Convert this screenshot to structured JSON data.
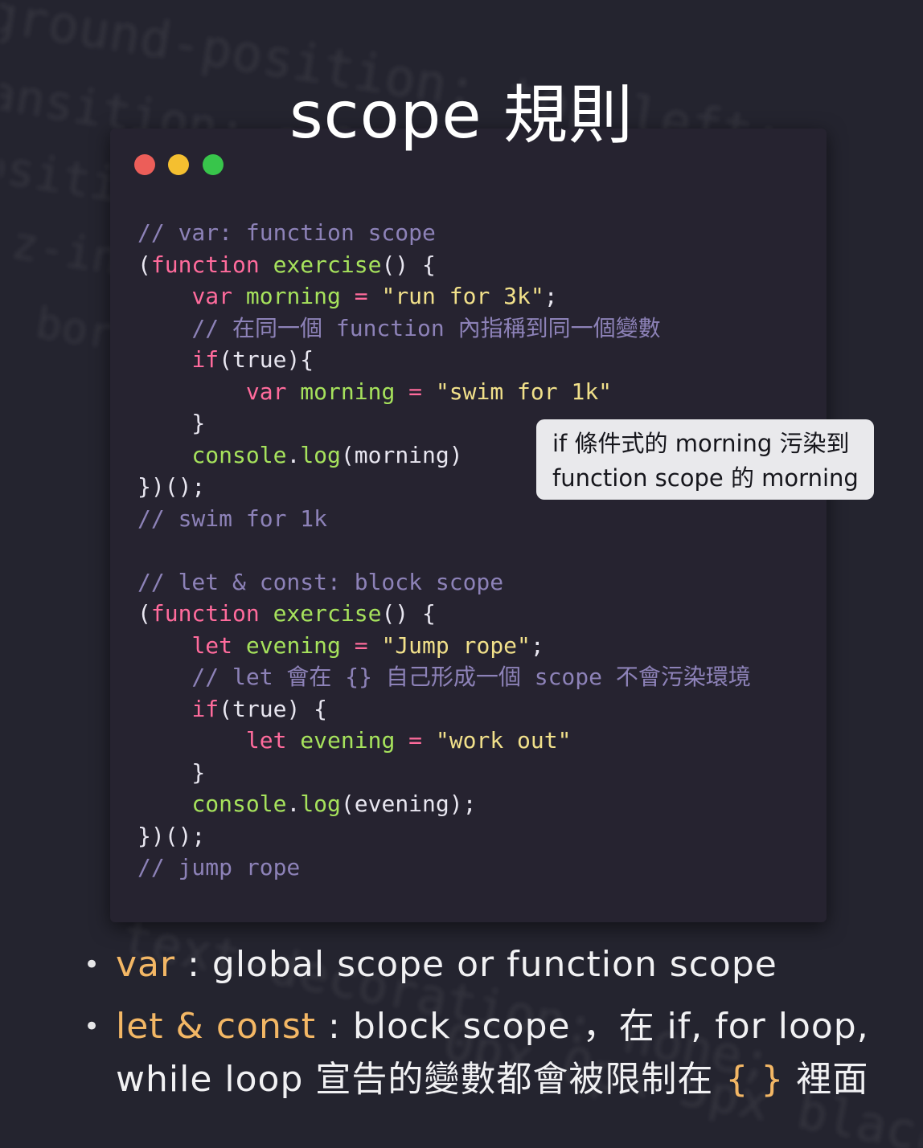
{
  "title": "scope 規則",
  "window_controls": {
    "close_color": "#ec5e59",
    "minimize_color": "#f4bf30",
    "maximize_color": "#38c54b"
  },
  "code_lines": [
    [
      {
        "t": "// var: function scope",
        "c": "comment"
      }
    ],
    [
      {
        "t": "(",
        "c": "plain"
      },
      {
        "t": "function",
        "c": "kw"
      },
      {
        "t": " ",
        "c": "plain"
      },
      {
        "t": "exercise",
        "c": "fn"
      },
      {
        "t": "() {",
        "c": "plain"
      }
    ],
    [
      {
        "t": "    ",
        "c": "plain"
      },
      {
        "t": "var",
        "c": "kw"
      },
      {
        "t": " ",
        "c": "plain"
      },
      {
        "t": "morning",
        "c": "fn"
      },
      {
        "t": " ",
        "c": "plain"
      },
      {
        "t": "=",
        "c": "kw"
      },
      {
        "t": " ",
        "c": "plain"
      },
      {
        "t": "\"run for 3k\"",
        "c": "str"
      },
      {
        "t": ";",
        "c": "plain"
      }
    ],
    [
      {
        "t": "    // 在同一個 function 內指稱到同一個變數",
        "c": "comment"
      }
    ],
    [
      {
        "t": "    ",
        "c": "plain"
      },
      {
        "t": "if",
        "c": "kw"
      },
      {
        "t": "(true){",
        "c": "plain"
      }
    ],
    [
      {
        "t": "        ",
        "c": "plain"
      },
      {
        "t": "var",
        "c": "kw"
      },
      {
        "t": " ",
        "c": "plain"
      },
      {
        "t": "morning",
        "c": "fn"
      },
      {
        "t": " ",
        "c": "plain"
      },
      {
        "t": "=",
        "c": "kw"
      },
      {
        "t": " ",
        "c": "plain"
      },
      {
        "t": "\"swim for 1k\"",
        "c": "str"
      }
    ],
    [
      {
        "t": "    }",
        "c": "plain"
      }
    ],
    [
      {
        "t": "    ",
        "c": "plain"
      },
      {
        "t": "console",
        "c": "fn"
      },
      {
        "t": ".",
        "c": "plain"
      },
      {
        "t": "log",
        "c": "fn"
      },
      {
        "t": "(morning)",
        "c": "plain"
      }
    ],
    [
      {
        "t": "})();",
        "c": "plain"
      }
    ],
    [
      {
        "t": "// swim for 1k",
        "c": "comment"
      }
    ],
    [
      {
        "t": "",
        "c": "plain"
      }
    ],
    [
      {
        "t": "// let & const: block scope",
        "c": "comment"
      }
    ],
    [
      {
        "t": "(",
        "c": "plain"
      },
      {
        "t": "function",
        "c": "kw"
      },
      {
        "t": " ",
        "c": "plain"
      },
      {
        "t": "exercise",
        "c": "fn"
      },
      {
        "t": "() {",
        "c": "plain"
      }
    ],
    [
      {
        "t": "    ",
        "c": "plain"
      },
      {
        "t": "let",
        "c": "kw"
      },
      {
        "t": " ",
        "c": "plain"
      },
      {
        "t": "evening",
        "c": "fn"
      },
      {
        "t": " ",
        "c": "plain"
      },
      {
        "t": "=",
        "c": "kw"
      },
      {
        "t": " ",
        "c": "plain"
      },
      {
        "t": "\"Jump rope\"",
        "c": "str"
      },
      {
        "t": ";",
        "c": "plain"
      }
    ],
    [
      {
        "t": "    // let 會在 {} 自己形成一個 scope 不會污染環境",
        "c": "comment"
      }
    ],
    [
      {
        "t": "    ",
        "c": "plain"
      },
      {
        "t": "if",
        "c": "kw"
      },
      {
        "t": "(true) {",
        "c": "plain"
      }
    ],
    [
      {
        "t": "        ",
        "c": "plain"
      },
      {
        "t": "let",
        "c": "kw"
      },
      {
        "t": " ",
        "c": "plain"
      },
      {
        "t": "evening",
        "c": "fn"
      },
      {
        "t": " ",
        "c": "plain"
      },
      {
        "t": "=",
        "c": "kw"
      },
      {
        "t": " ",
        "c": "plain"
      },
      {
        "t": "\"work out\"",
        "c": "str"
      }
    ],
    [
      {
        "t": "    }",
        "c": "plain"
      }
    ],
    [
      {
        "t": "    ",
        "c": "plain"
      },
      {
        "t": "console",
        "c": "fn"
      },
      {
        "t": ".",
        "c": "plain"
      },
      {
        "t": "log",
        "c": "fn"
      },
      {
        "t": "(evening);",
        "c": "plain"
      }
    ],
    [
      {
        "t": "})();",
        "c": "plain"
      }
    ],
    [
      {
        "t": "// jump rope",
        "c": "comment"
      }
    ]
  ],
  "code_colors": {
    "comment": "#8d82b8",
    "keyword": "#ff6b9c",
    "identifier": "#a6e25c",
    "string": "#f1e08a",
    "plain": "#e8e6f0"
  },
  "callout": {
    "line1": "if 條件式的 morning 污染到",
    "line2": "function scope 的 morning"
  },
  "notes": {
    "var_term": "var",
    "var_desc": " : global scope or function scope",
    "let_term": "let & const",
    "let_desc": " : block scope ，在 if, for loop,",
    "let_desc_cont_prefix": "while loop 宣告的變數都會被限制在 ",
    "braces": "{ }",
    "let_desc_cont_suffix": " 裡面",
    "highlight_color": "#f3b765"
  },
  "background_code": [
    "ground-position: top left;",
    "ansition: all .3s",
    "ositi",
    "z-ind",
    "bor",
    "text-decoration: none;",
    "0px 0px 5px black;"
  ]
}
